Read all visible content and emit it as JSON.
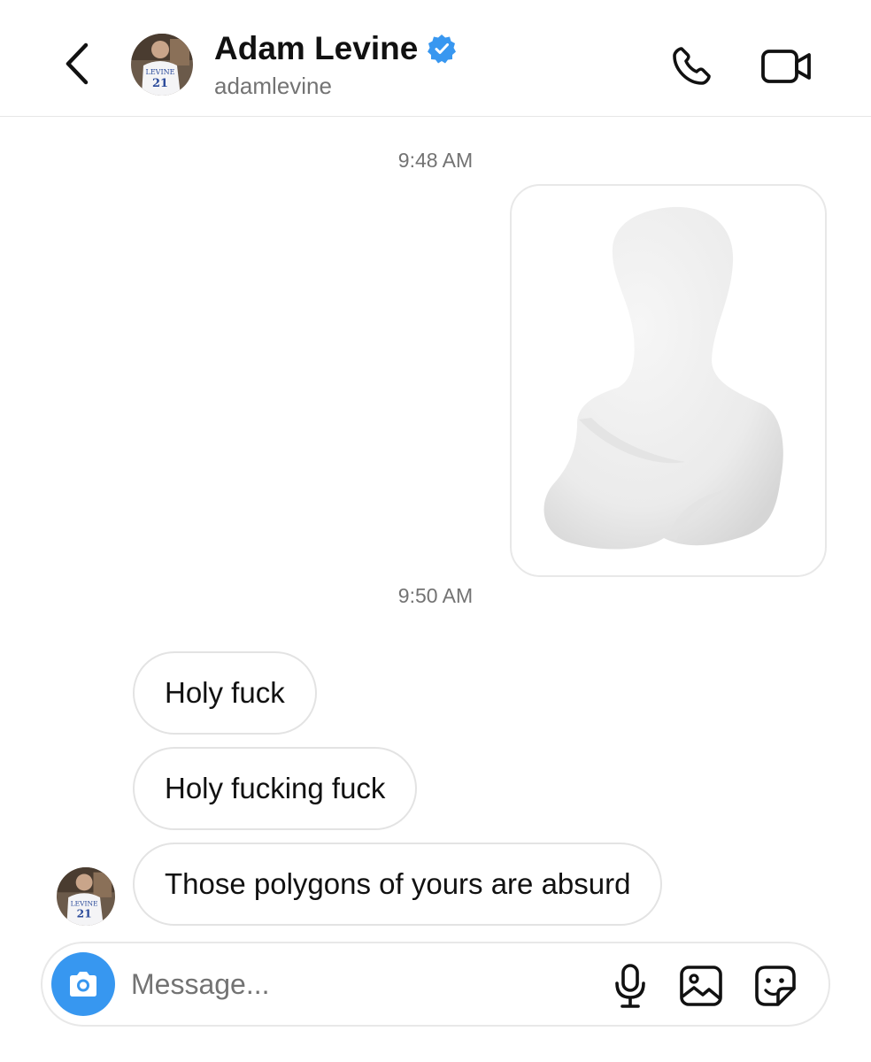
{
  "header": {
    "name": "Adam Levine",
    "handle": "adamlevine",
    "verified": true,
    "avatar_jersey_name": "LEVINE",
    "avatar_jersey_number": "21"
  },
  "icons": {
    "back": "chevron-left-icon",
    "call": "phone-icon",
    "video": "video-camera-icon",
    "verified": "verified-badge-icon",
    "camera": "camera-icon",
    "mic": "microphone-icon",
    "gallery": "image-icon",
    "sticker": "sticker-icon"
  },
  "conversation": {
    "timestamp_1": "9:48 AM",
    "timestamp_2": "9:50 AM",
    "messages": [
      {
        "text": "Holy fuck"
      },
      {
        "text": "Holy fucking fuck"
      },
      {
        "text": "Those polygons of yours are absurd"
      }
    ]
  },
  "composer": {
    "placeholder": "Message..."
  },
  "colors": {
    "accent": "#3797f0",
    "verified": "#3897f0",
    "secondary_text": "#737373",
    "border": "#e3e3e3"
  }
}
